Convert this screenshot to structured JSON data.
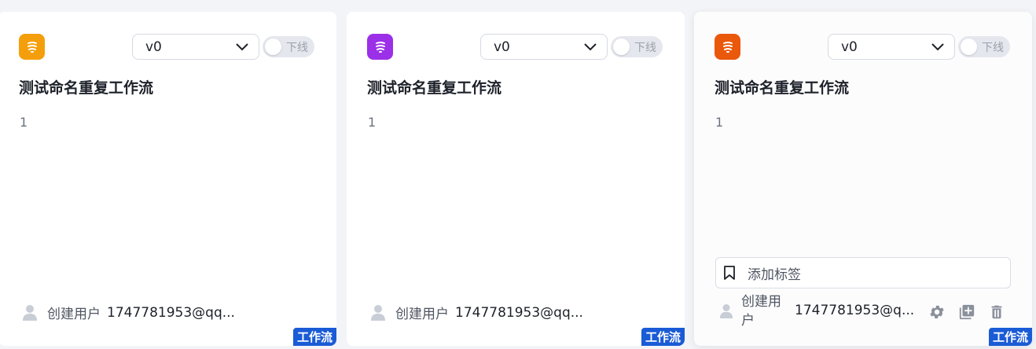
{
  "cards": [
    {
      "icon_color": "#f59e0b",
      "version": "v0",
      "toggle_label": "下线",
      "title": "测试命名重复工作流",
      "description": "1",
      "creator_label": "创建用户",
      "creator": "1747781953@qq...",
      "type_badge": "工作流"
    },
    {
      "icon_color": "#9b30e8",
      "version": "v0",
      "toggle_label": "下线",
      "title": "测试命名重复工作流",
      "description": "1",
      "creator_label": "创建用户",
      "creator": "1747781953@qq...",
      "type_badge": "工作流"
    },
    {
      "icon_color": "#ea580c",
      "version": "v0",
      "toggle_label": "下线",
      "title": "测试命名重复工作流",
      "description": "1",
      "tag_placeholder": "添加标签",
      "creator_label": "创建用户",
      "creator": "1747781953@q...",
      "type_badge": "工作流",
      "actions": [
        "settings-icon",
        "copy-add-icon",
        "delete-icon"
      ]
    }
  ]
}
